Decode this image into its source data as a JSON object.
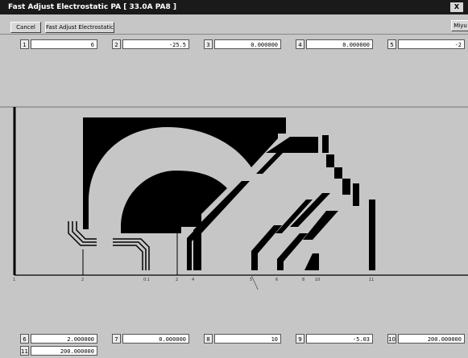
{
  "window": {
    "title": "Fast Adjust Electrostatic PA [ 33.0A PA8 ]",
    "control": "X"
  },
  "toolbar": {
    "cancel_label": "Cancel",
    "fast_adjust_label": "Fast Adjust Electrostatic PA",
    "right_button_label": "Miyu"
  },
  "top_fields": [
    {
      "num": "1",
      "value": "6"
    },
    {
      "num": "2",
      "value": "-25.5"
    },
    {
      "num": "3",
      "value": "0.000000"
    },
    {
      "num": "4",
      "value": "0.000000"
    },
    {
      "num": "5",
      "value": "-2"
    }
  ],
  "bottom_fields": [
    {
      "num": "6",
      "value": "2.000000"
    },
    {
      "num": "7",
      "value": "0.000000"
    },
    {
      "num": "8",
      "value": "10"
    },
    {
      "num": "9",
      "value": "-5.03"
    },
    {
      "num": "10",
      "value": "200.000000"
    },
    {
      "num": "11",
      "value": "200.000000"
    }
  ],
  "axis_labels": [
    "1",
    "2",
    "0.1",
    "2",
    "4",
    "5",
    "6",
    "8",
    "10",
    "11"
  ],
  "colors": {
    "background": "#c6c6c6",
    "electrode": "#000000",
    "titlebar": "#1a1a1a"
  }
}
